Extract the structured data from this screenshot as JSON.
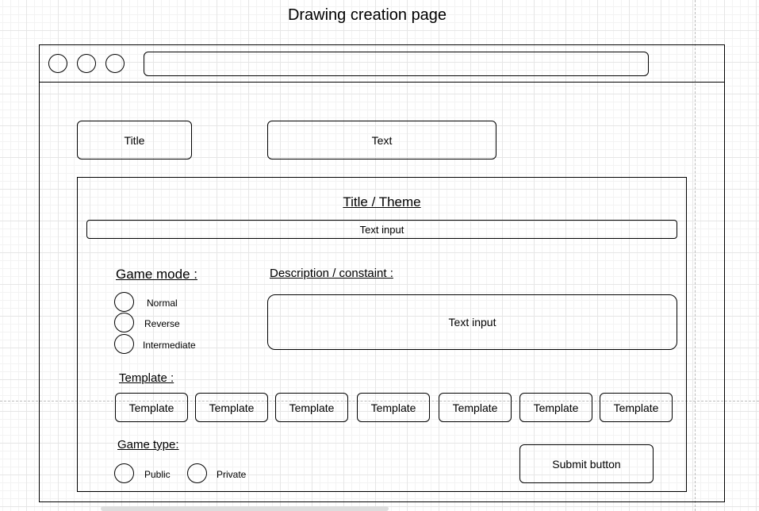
{
  "page_title": "Drawing creation page",
  "header": {
    "title_label": "Title",
    "text_label": "Text"
  },
  "form": {
    "heading": "Title / Theme ",
    "title_input": "Text input",
    "game_mode": {
      "label": "Game mode :",
      "options": [
        "Normal",
        "Reverse",
        "Intermediate"
      ]
    },
    "description": {
      "label": "Description / constaint :",
      "input": "Text input"
    },
    "template": {
      "label": "Template :",
      "items": [
        "Template",
        "Template",
        "Template",
        "Template",
        "Template",
        "Template",
        "Template"
      ]
    },
    "game_type": {
      "label": "Game type:",
      "options": [
        "Public",
        "Private"
      ]
    },
    "submit_label": "Submit button"
  }
}
